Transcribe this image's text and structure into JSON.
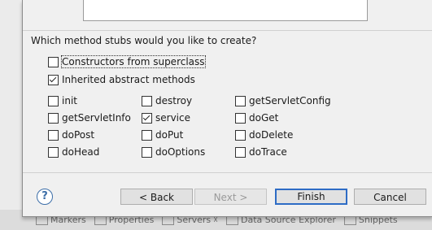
{
  "background_tabs": [
    {
      "label": "Markers",
      "icon": "markers-icon"
    },
    {
      "label": "Properties",
      "icon": "properties-icon"
    },
    {
      "label": "Servers",
      "icon": "servers-icon",
      "close": "☓"
    },
    {
      "label": "Data Source Explorer",
      "icon": "data-source-icon"
    },
    {
      "label": "Snippets",
      "icon": "snippets-icon"
    }
  ],
  "question": "Which method stubs would you like to create?",
  "options": {
    "constructors": {
      "label": "Constructors from superclass",
      "checked": false
    },
    "inherited": {
      "label": "Inherited abstract methods",
      "checked": true
    }
  },
  "stubs": [
    {
      "label": "init",
      "checked": false
    },
    {
      "label": "destroy",
      "checked": false
    },
    {
      "label": "getServletConfig",
      "checked": false
    },
    {
      "label": "getServletInfo",
      "checked": false
    },
    {
      "label": "service",
      "checked": true
    },
    {
      "label": "doGet",
      "checked": false
    },
    {
      "label": "doPost",
      "checked": false
    },
    {
      "label": "doPut",
      "checked": false
    },
    {
      "label": "doDelete",
      "checked": false
    },
    {
      "label": "doHead",
      "checked": false
    },
    {
      "label": "doOptions",
      "checked": false
    },
    {
      "label": "doTrace",
      "checked": false
    }
  ],
  "buttons": {
    "help": "?",
    "back": "< Back",
    "next": "Next >",
    "finish": "Finish",
    "cancel": "Cancel"
  },
  "colors": {
    "accent": "#2e6cc5",
    "help": "#3c6ea8"
  }
}
